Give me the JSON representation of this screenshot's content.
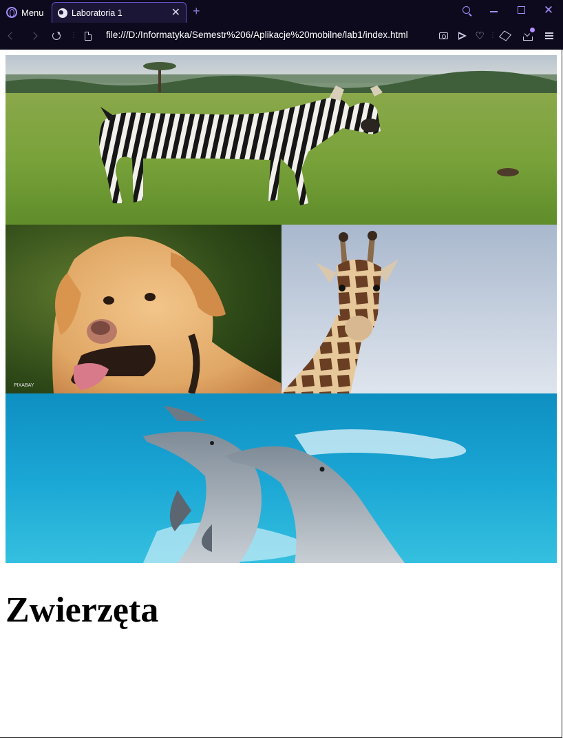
{
  "browser": {
    "menu_label": "Menu",
    "tab_title": "Laboratoria 1",
    "url": "file:///D:/Informatyka/Semestr%206/Aplikacje%20mobilne/lab1/index.html",
    "accent_color": "#a58cff",
    "chrome_background": "#0c0a1c"
  },
  "page": {
    "images": [
      {
        "subject": "zebra",
        "alt": "Zebra"
      },
      {
        "subject": "dog",
        "alt": "Pies",
        "watermark": "PIXABAY"
      },
      {
        "subject": "giraffe",
        "alt": "Żyrafa"
      },
      {
        "subject": "dolphins",
        "alt": "Delfiny"
      }
    ],
    "heading": "Zwierzęta"
  }
}
